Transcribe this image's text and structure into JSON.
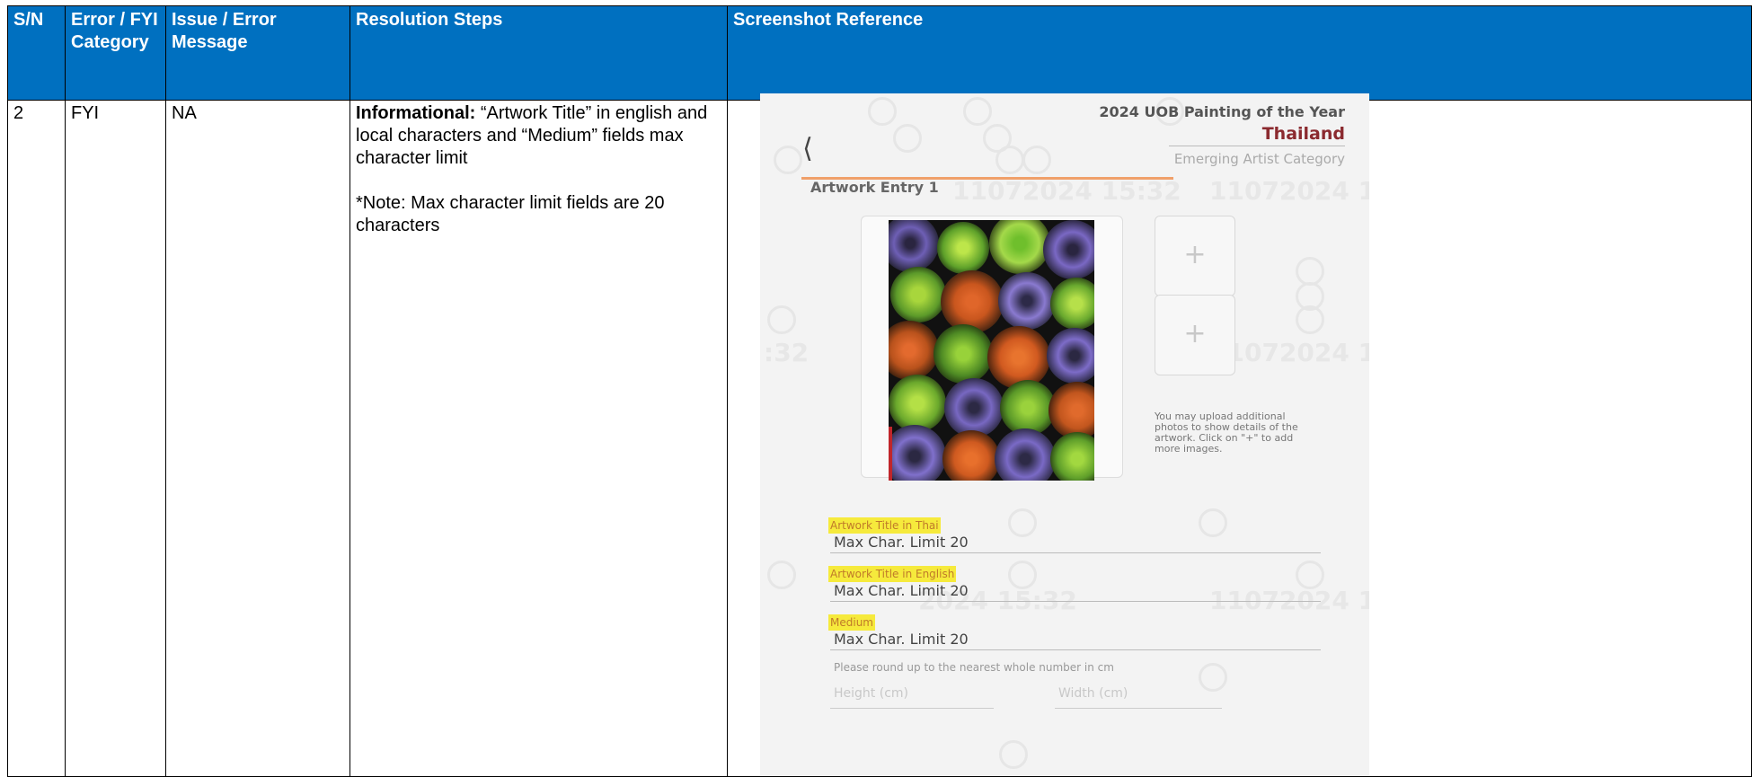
{
  "table": {
    "headers": {
      "sn": "S/N",
      "category": "Error / FYI Category",
      "issue": "Issue / Error Message",
      "resolution": "Resolution Steps",
      "screenshot": "Screenshot Reference"
    },
    "row": {
      "sn": "2",
      "category": "FYI",
      "issue": "NA",
      "resolution_bold": "Informational:",
      "resolution_text": " “Artwork Title” in english and local characters and “Medium” fields max character limit",
      "resolution_note": "*Note: Max character limit fields are 20 characters"
    }
  },
  "screenshot": {
    "header": {
      "competition": "2024 UOB Painting of the Year",
      "country": "Thailand",
      "category": "Emerging Artist Category"
    },
    "back_icon": "chevron-left-icon",
    "entry_title": "Artwork Entry 1",
    "add_icon": "+",
    "upload_note": "You may upload additional photos to show details of the artwork. Click on \"+\" to add more images.",
    "watermark": "11072024 15:32",
    "watermark_parts": [
      ":32",
      "2024 15:32"
    ],
    "fields": [
      {
        "label": "Artwork Title in Thai",
        "value": "Max Char. Limit 20"
      },
      {
        "label": "Artwork Title in English",
        "value": "Max Char. Limit 20"
      },
      {
        "label": "Medium",
        "value": "Max Char. Limit 20"
      }
    ],
    "hint": "Please round up to the nearest whole number in cm",
    "height_label": "Height (cm)",
    "width_label": "Width (cm)",
    "colors": {
      "header_blue": "#0070c0",
      "country_red": "#8b2a2f",
      "accent_orange": "#f0a06a",
      "highlight_yellow": "#f6ea3c"
    }
  }
}
